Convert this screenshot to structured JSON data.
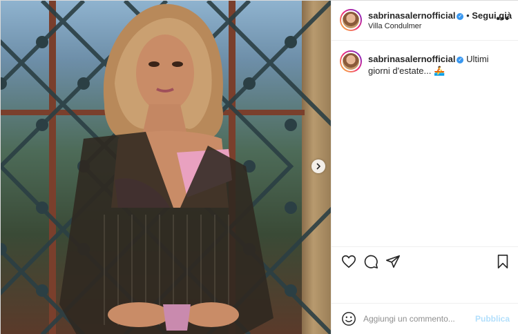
{
  "post": {
    "username": "sabrinasalernofficial",
    "verified": true,
    "follow_state": "Segui già",
    "separator": "•",
    "location": "Villa Condulmer",
    "more_icon": "more-horizontal-icon"
  },
  "caption": {
    "username": "sabrinasalernofficial",
    "text": "Ultimi giorni d'estate... 🚣"
  },
  "actions": {
    "like_icon": "heart-icon",
    "comment_icon": "comment-icon",
    "share_icon": "send-icon",
    "save_icon": "bookmark-icon"
  },
  "comment_box": {
    "placeholder": "Aggiungi un commento...",
    "post_label": "Pubblica"
  },
  "media": {
    "next_icon": "chevron-right-icon"
  },
  "colors": {
    "verified_blue": "#3897f0",
    "post_button_disabled": "#b2dffc",
    "text_primary": "#262626",
    "text_secondary": "#8e8e8e",
    "divider": "#efefef"
  }
}
